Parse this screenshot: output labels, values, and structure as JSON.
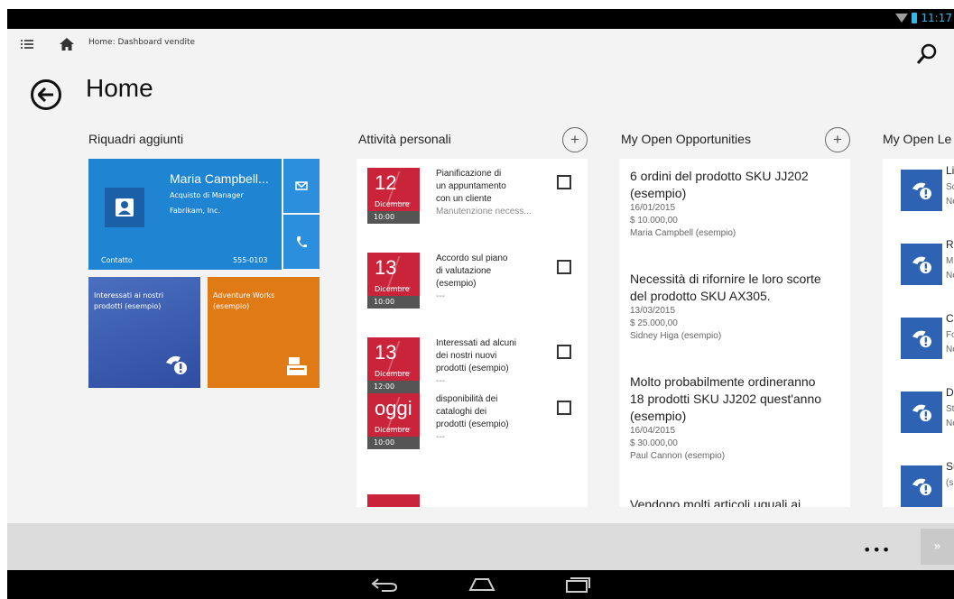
{
  "status_bar": {
    "time": "11:17"
  },
  "header": {
    "breadcrumb": "Home: Dashboard vendite"
  },
  "page": {
    "title": "Home"
  },
  "columns": {
    "pinned": {
      "title": "Riquadri aggiunti"
    },
    "activities": {
      "title": "Attività personali"
    },
    "opportunities": {
      "title": "My Open Opportunities"
    },
    "leads": {
      "title": "My Open Le"
    }
  },
  "contact_tile": {
    "name": "Maria Campbell...",
    "role": "Acquisto di Manager",
    "company": "Fabrikam, Inc.",
    "type_label": "Contatto",
    "phone": "555-0103"
  },
  "small_tiles": [
    {
      "label": "Interessati ai nostri prodotti (esempio)",
      "color": "#3a5cb0"
    },
    {
      "label": "Adventure Works (esempio)",
      "color": "#e07a14"
    }
  ],
  "activities": [
    {
      "day": "12",
      "month": "Dicembre",
      "time": "10:00",
      "lines": [
        "Pianificazione di",
        "un appuntamento",
        "con un cliente"
      ],
      "sub": "Manutenzione necess..."
    },
    {
      "day": "13",
      "month": "Dicembre",
      "time": "10:00",
      "lines": [
        "Accordo sul piano",
        "di valutazione",
        "(esempio)"
      ],
      "sub": "---"
    },
    {
      "day": "13",
      "month": "Dicembre",
      "time": "12:00",
      "lines": [
        "Interessati ad alcuni",
        "dei nostri nuovi",
        "prodotti (esempio)"
      ],
      "sub": "---"
    },
    {
      "day": "oggi",
      "month": "Dicembre",
      "time": "10:00",
      "lines": [
        "disponibilità dei",
        "cataloghi dei",
        "prodotti (esempio)"
      ],
      "sub": "---"
    }
  ],
  "opportunities": [
    {
      "title": [
        "6 ordini del prodotto SKU JJ202",
        "(esempio)"
      ],
      "date": "16/01/2015",
      "amount": "$ 10.000,00",
      "owner": "Maria Campbell (esempio)"
    },
    {
      "title": [
        "Necessità di rifornire le loro scorte",
        "del prodotto SKU AX305."
      ],
      "date": "13/03/2015",
      "amount": "$ 25.000,00",
      "owner": "Sidney Higa (esempio)"
    },
    {
      "title": [
        "Molto probabilmente ordineranno",
        "18 prodotti SKU JJ202 quest'anno",
        "(esempio)"
      ],
      "date": "16/04/2015",
      "amount": "$ 30.000,00",
      "owner": "Paul Cannon (esempio)"
    },
    {
      "title": [
        "Vendono molti articoli uguali ai"
      ],
      "date": "",
      "amount": "",
      "owner": ""
    }
  ],
  "leads": [
    {
      "t1": "Li",
      "t2": "Sc",
      "t3": "Ne"
    },
    {
      "t1": "Ro",
      "t2": "M",
      "t3": "Ne"
    },
    {
      "t1": "Co",
      "t2": "Fo",
      "t3": "Ne"
    },
    {
      "t1": "D",
      "t2": "Ste",
      "t3": "Ne"
    },
    {
      "t1": "Su",
      "t2": "(s",
      "t3": ""
    }
  ],
  "app_bar": {
    "more": "•••",
    "next": "»"
  },
  "colors": {
    "accent": "#1f84d1",
    "activity_red": "#c9243a",
    "lead_blue": "#2e63b3",
    "status_blue": "#33b5e5"
  }
}
